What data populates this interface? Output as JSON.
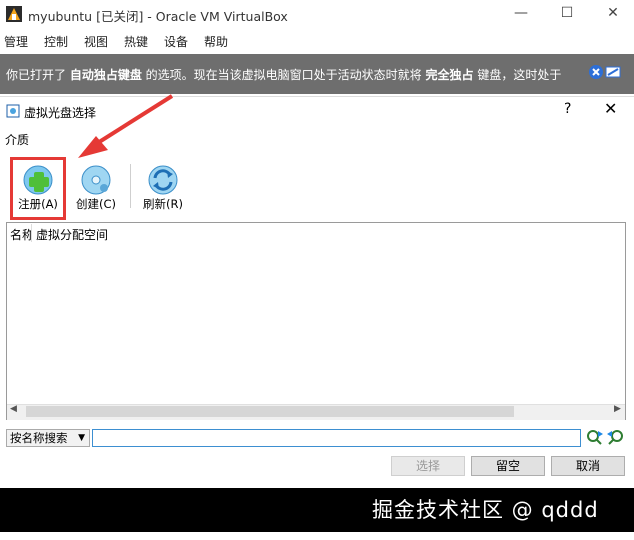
{
  "window": {
    "title": "myubuntu [已关闭] - Oracle VM VirtualBox",
    "controls": [
      "—",
      "☐",
      "✕"
    ]
  },
  "menu": [
    "管理",
    "控制",
    "视图",
    "热键",
    "设备",
    "帮助"
  ],
  "notice": {
    "p1": "你已打开了 ",
    "b1": "自动独占键盘",
    "p2": " 的选项。现在当该虚拟电脑窗口处于活动状态时就将 ",
    "b2": "完全独占",
    "p3": " 键盘，这时处于"
  },
  "dialog": {
    "title": "虚拟光盘选择",
    "help": "?",
    "close": "✕",
    "media_label": "介质",
    "toolbar": {
      "register": "注册(A)",
      "create": "创建(C)",
      "refresh": "刷新(R)"
    },
    "columns": [
      "名称",
      "虚拟分配空间"
    ],
    "search_mode": "按名称搜索",
    "search_value": "",
    "buttons": {
      "choose": "选择",
      "leave_empty": "留空",
      "cancel": "取消"
    }
  },
  "watermark": "掘金技术社区 @ qddd",
  "colors": {
    "highlight": "#e53935",
    "notice_bg": "#6e6e6e",
    "accent": "#3d8fd1"
  }
}
